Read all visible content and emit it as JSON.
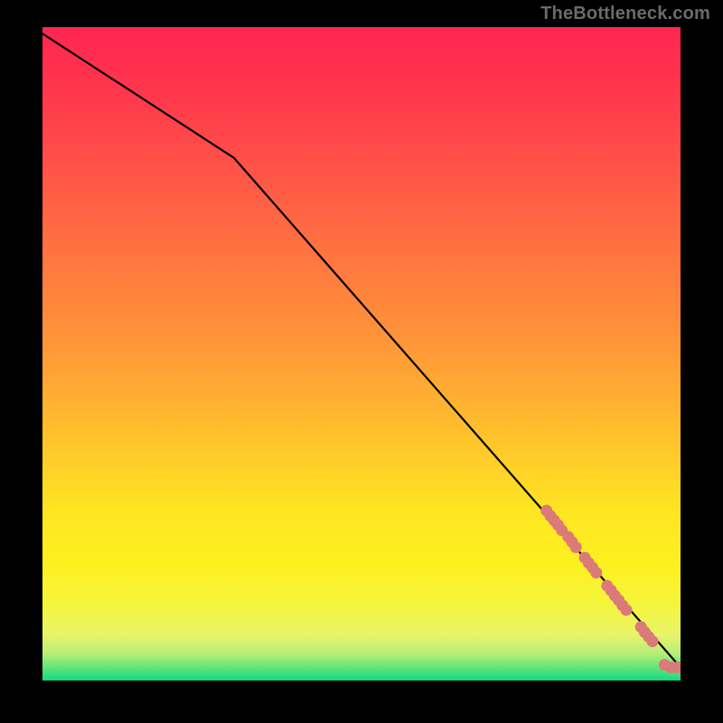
{
  "watermark": "TheBottleneck.com",
  "colors": {
    "frame_bg": "#000000",
    "watermark": "#6b6b6b",
    "curve": "#000000",
    "dot": "#db7a79",
    "gradient_stops": [
      "#ff2551",
      "#ff3b4c",
      "#ff5946",
      "#ff773f",
      "#ff9538",
      "#ffb330",
      "#ffd028",
      "#fee721",
      "#fdf01f",
      "#f6f43a",
      "#e9f469",
      "#b4ed78",
      "#4ee27a",
      "#16da82"
    ]
  },
  "chart_data": {
    "type": "line",
    "title": "",
    "xlabel": "",
    "ylabel": "",
    "xlim": [
      0,
      100
    ],
    "ylim": [
      0,
      100
    ],
    "series": [
      {
        "name": "curve",
        "x": [
          0,
          30,
          100
        ],
        "y": [
          99,
          80,
          2
        ]
      }
    ],
    "scatter_points": {
      "name": "salmon-dots",
      "color": "#db7a79",
      "points": [
        {
          "x": 79.0,
          "y": 26.0
        },
        {
          "x": 79.6,
          "y": 25.2
        },
        {
          "x": 80.2,
          "y": 24.5
        },
        {
          "x": 80.8,
          "y": 23.8
        },
        {
          "x": 81.4,
          "y": 23.0
        },
        {
          "x": 82.4,
          "y": 22.0
        },
        {
          "x": 83.0,
          "y": 21.2
        },
        {
          "x": 83.6,
          "y": 20.4
        },
        {
          "x": 85.0,
          "y": 18.8
        },
        {
          "x": 85.6,
          "y": 18.0
        },
        {
          "x": 86.2,
          "y": 17.3
        },
        {
          "x": 86.8,
          "y": 16.5
        },
        {
          "x": 88.5,
          "y": 14.5
        },
        {
          "x": 89.1,
          "y": 13.8
        },
        {
          "x": 89.7,
          "y": 13.0
        },
        {
          "x": 90.3,
          "y": 12.3
        },
        {
          "x": 90.9,
          "y": 11.5
        },
        {
          "x": 91.5,
          "y": 10.8
        },
        {
          "x": 93.8,
          "y": 8.2
        },
        {
          "x": 94.4,
          "y": 7.4
        },
        {
          "x": 95.0,
          "y": 6.7
        },
        {
          "x": 95.6,
          "y": 6.0
        },
        {
          "x": 97.5,
          "y": 2.4
        },
        {
          "x": 98.5,
          "y": 2.0
        },
        {
          "x": 99.5,
          "y": 2.0
        },
        {
          "x": 100.0,
          "y": 2.0
        }
      ]
    }
  }
}
